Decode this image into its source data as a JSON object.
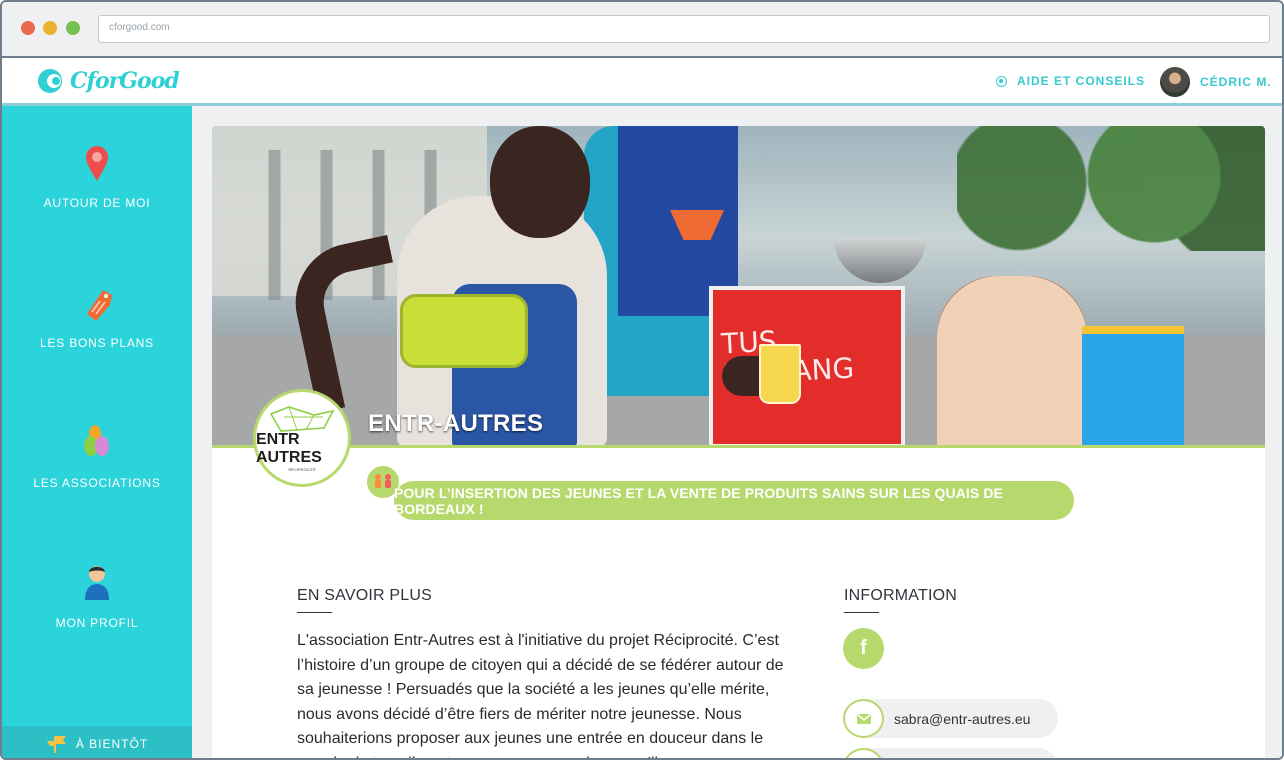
{
  "browser": {
    "url": "cforgood.com"
  },
  "header": {
    "logo_text": "CforGood",
    "help_label": "AIDE ET CONSEILS",
    "user_name": "CÉDRIC M."
  },
  "sidebar": {
    "items": [
      {
        "label": "AUTOUR DE MOI",
        "icon": "location-pin-icon"
      },
      {
        "label": "LES BONS PLANS",
        "icon": "price-tag-icon"
      },
      {
        "label": "LES ASSOCIATIONS",
        "icon": "hands-icon"
      },
      {
        "label": "MON PROFIL",
        "icon": "user-profile-icon"
      }
    ],
    "bottom_label": "À BIENTÔT"
  },
  "organization": {
    "name": "ENTR-AUTRES",
    "badge_name": "ENTR AUTRES",
    "badge_subtitle": "RÉCIPROCITÉ",
    "tagline": "POUR L’INSERTION DES JEUNES ET LA VENTE DE PRODUITS SAINS SUR LES QUAIS DE BORDEAUX !",
    "hero_sign_text": "TUS\nD'ORANG"
  },
  "content": {
    "about_title": "EN SAVOIR PLUS",
    "about_text": "L'association Entr-Autres est à l'initiative du projet Réciprocité. C’est l’histoire d’un groupe de citoyen qui a décidé de se fédérer autour de sa jeunesse ! Persuadés que la société a les jeunes qu’elle mérite, nous avons décidé d’être fiers de mériter notre jeunesse. Nous souhaiterions proposer aux jeunes une entrée en douceur dans le monde du travail, un temps pour apprendre ce qu’ils",
    "info_title": "INFORMATION",
    "facebook_label": "f",
    "email": "sabra@entr-autres.eu"
  },
  "colors": {
    "accent": "#2bd3da",
    "secondary": "#b7d86c"
  }
}
